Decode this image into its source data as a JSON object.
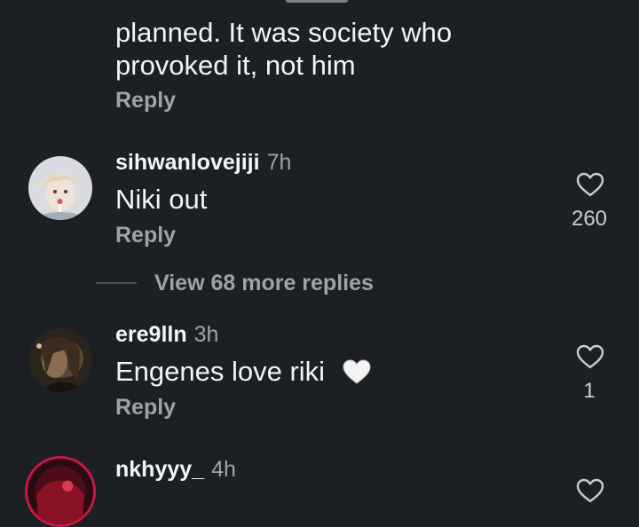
{
  "comments": [
    {
      "text_lines": [
        "planned. It was society who",
        "provoked it, not him"
      ],
      "reply_label": "Reply"
    },
    {
      "username": "sihwanlovejiji",
      "time": "7h",
      "text": "Niki out",
      "reply_label": "Reply",
      "likes": "260"
    },
    {
      "username": "ere9lln",
      "time": "3h",
      "text": "Engenes love riki",
      "emoji": "white-heart",
      "reply_label": "Reply",
      "likes": "1"
    },
    {
      "username": "nkhyyy_",
      "time": "4h"
    }
  ],
  "view_more": "View 68 more replies",
  "colors": {
    "background": "#1c1f24",
    "primary_text": "#f3f4f6",
    "secondary_text": "#9ea3ab"
  }
}
